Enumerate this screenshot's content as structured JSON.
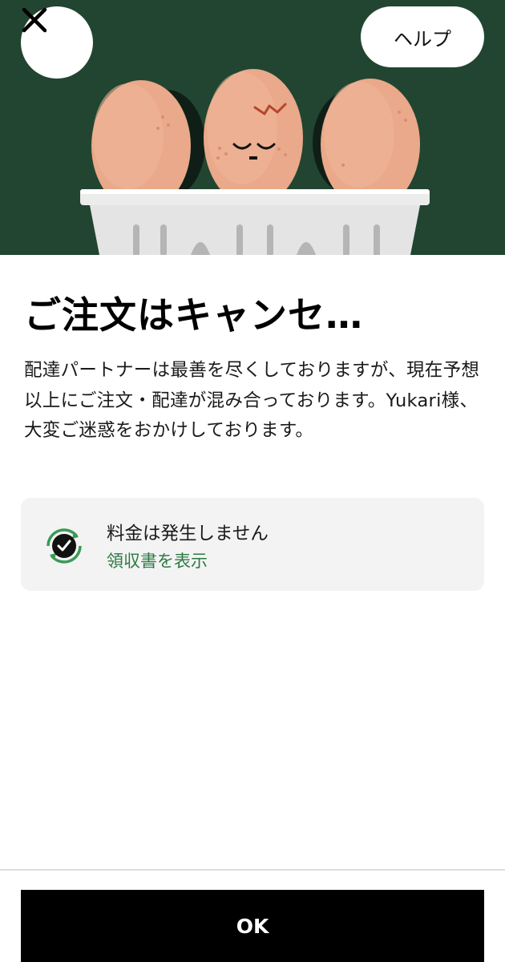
{
  "header": {
    "help_label": "ヘルプ",
    "close_icon": "close-icon",
    "illustration": "cracked-egg-carton-illustration"
  },
  "main": {
    "title": "ご注文はキャンセ…",
    "message": "配達パートナーは最善を尽くしておりますが、現在予想以上にご注文・配達が混み合っております。Yukari様、大変ご迷惑をおかけしております。"
  },
  "fee_card": {
    "icon": "refund-check-icon",
    "label": "料金は発生しません",
    "link_label": "領収書を表示"
  },
  "footer": {
    "ok_label": "OK"
  },
  "colors": {
    "hero_background": "#214531",
    "link_green": "#2c7a43",
    "button_black": "#000000",
    "card_background": "#f3f3f3"
  }
}
